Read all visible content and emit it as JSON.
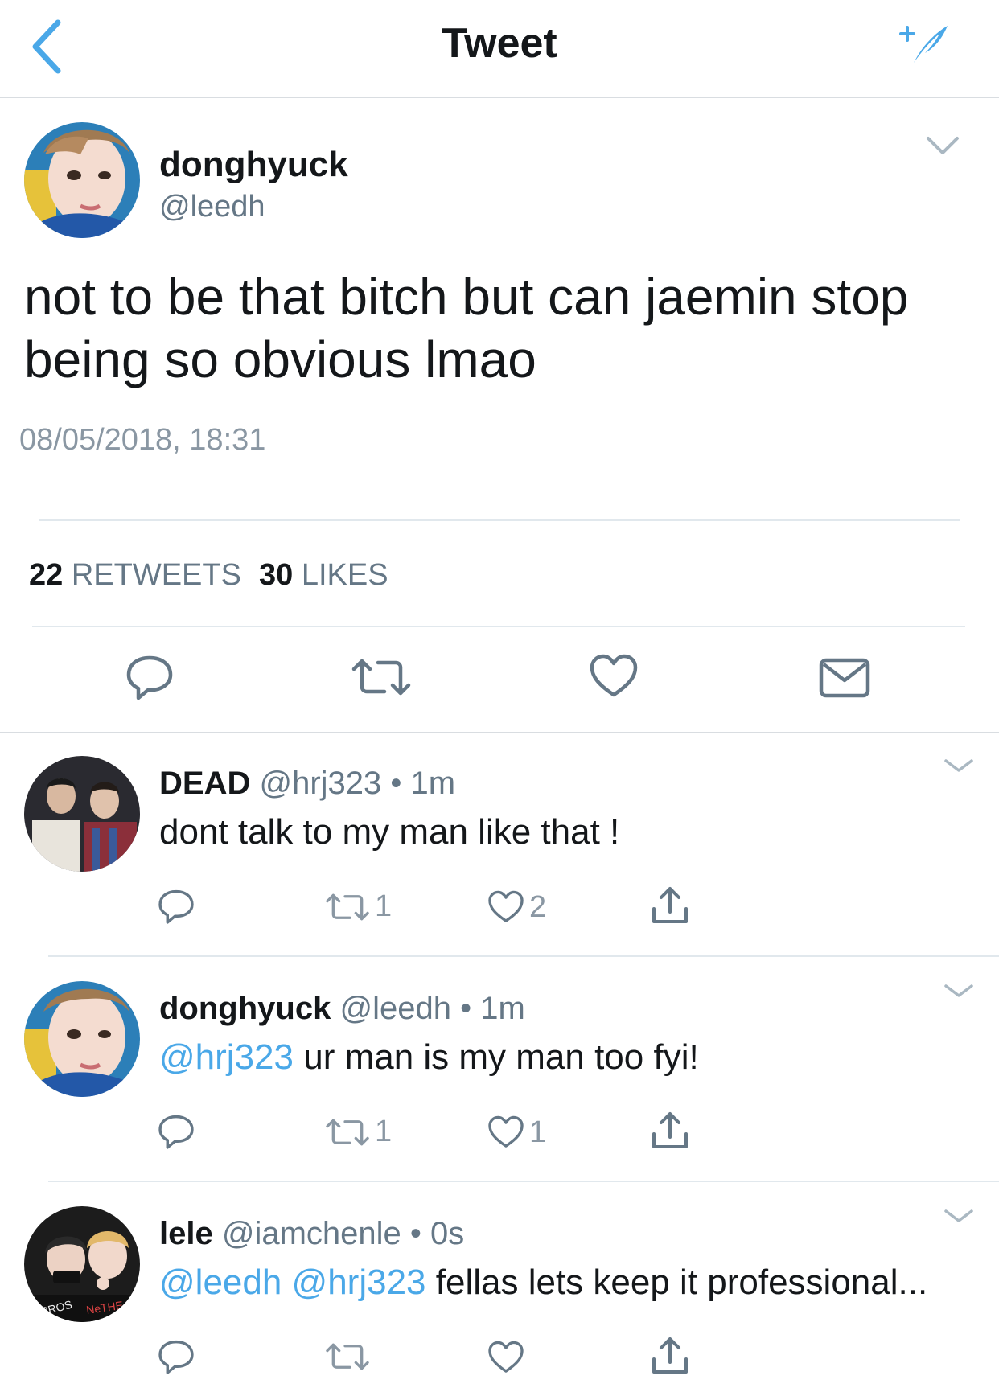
{
  "header": {
    "title": "Tweet",
    "back_icon": "chevron-left-icon",
    "compose_icon": "compose-tweet-icon"
  },
  "colors": {
    "accent": "#4aa8e8",
    "text": "#14171a",
    "secondary": "#657786",
    "divider": "#e1e8ed"
  },
  "tweet": {
    "name": "donghyuck",
    "handle": "@leedh",
    "text": "not to be that bitch but can jaemin stop being so obvious lmao",
    "timestamp": "08/05/2018, 18:31",
    "retweets": "22",
    "retweets_label": "RETWEETS",
    "likes": "30",
    "likes_label": "LIKES",
    "actions": [
      "reply-icon",
      "retweet-icon",
      "like-icon",
      "direct-message-icon"
    ]
  },
  "replies": [
    {
      "name": "DEAD",
      "handle": "@hrj323",
      "sep": "•",
      "time": "1m",
      "mentions": "",
      "text": "dont talk to my man like that !",
      "retweets": "1",
      "likes": "2"
    },
    {
      "name": "donghyuck",
      "handle": "@leedh",
      "sep": "•",
      "time": "1m",
      "mentions": "@hrj323",
      "text": "ur man is my man too fyi!",
      "retweets": "1",
      "likes": "1"
    },
    {
      "name": "lele",
      "handle": "@iamchenle",
      "sep": "•",
      "time": "0s",
      "mentions": "@leedh @hrj323",
      "text": "fellas lets keep it professional...",
      "retweets": "",
      "likes": ""
    }
  ]
}
